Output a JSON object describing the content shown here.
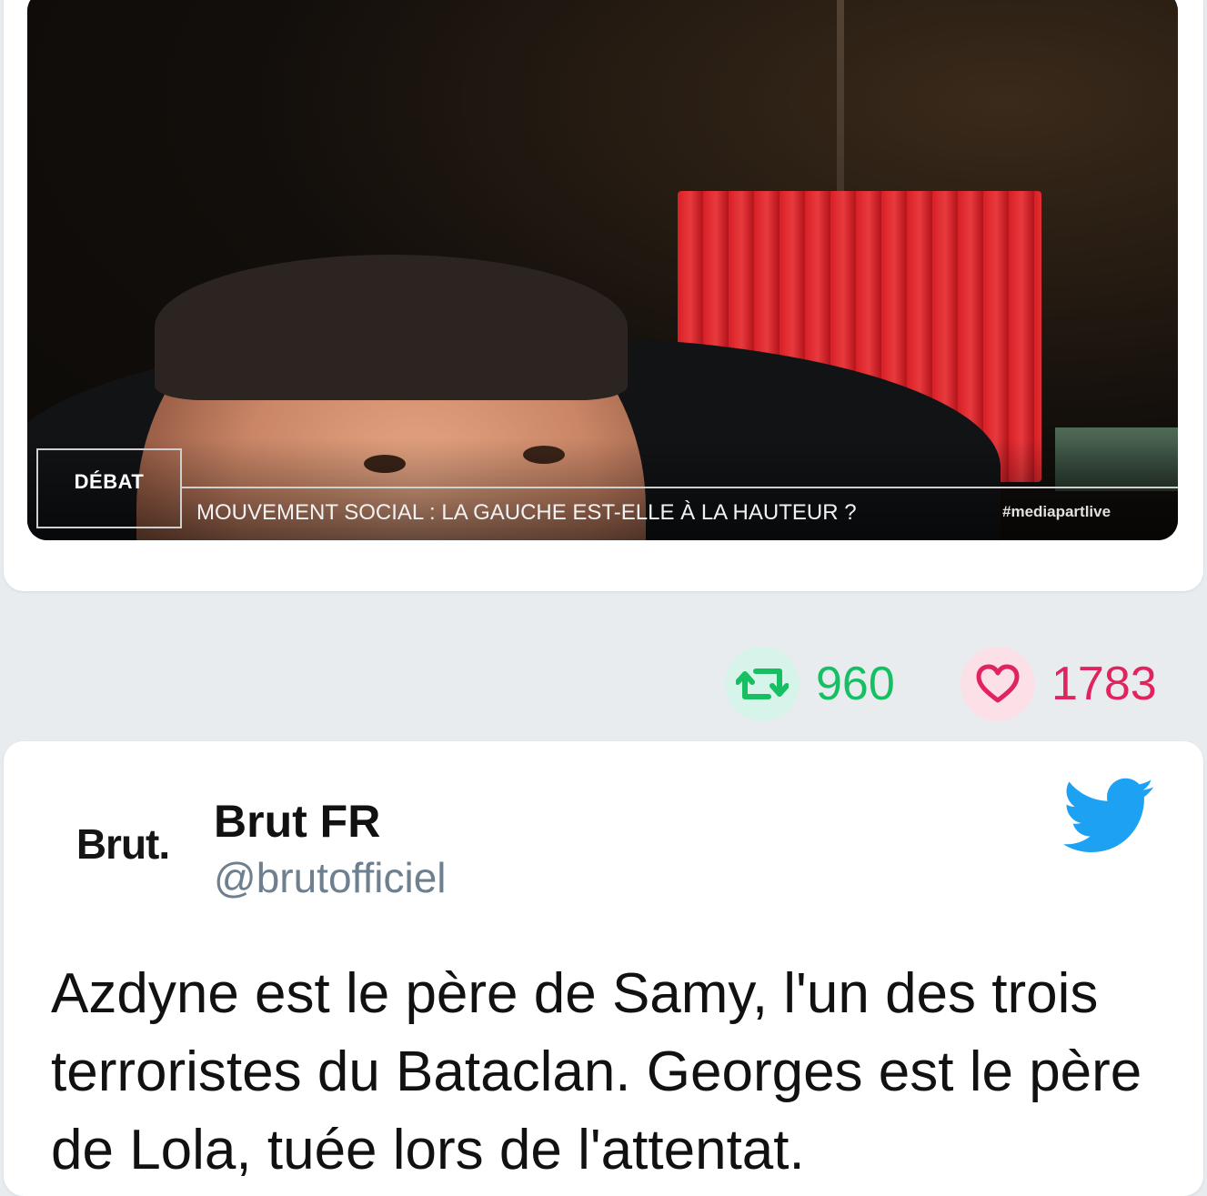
{
  "media": {
    "tag": "DÉBAT",
    "headline": "MOUVEMENT SOCIAL : LA GAUCHE EST-ELLE À LA HAUTEUR ?",
    "hashtag": "#mediapartlive"
  },
  "actions": {
    "retweets": "960",
    "likes": "1783",
    "retweet_icon": "retweet-icon",
    "like_icon": "heart-icon",
    "retweet_color": "#17bf63",
    "like_color": "#e0245e"
  },
  "tweet": {
    "avatar_text": "Brut.",
    "name": "Brut FR",
    "handle": "@brutofficiel",
    "logo_icon": "twitter-bird-icon",
    "logo_color": "#1da1f2",
    "text": "Azdyne est le père de Samy, l'un des trois terroristes du Bataclan. Georges est le père de Lola, tuée lors de l'attentat."
  }
}
